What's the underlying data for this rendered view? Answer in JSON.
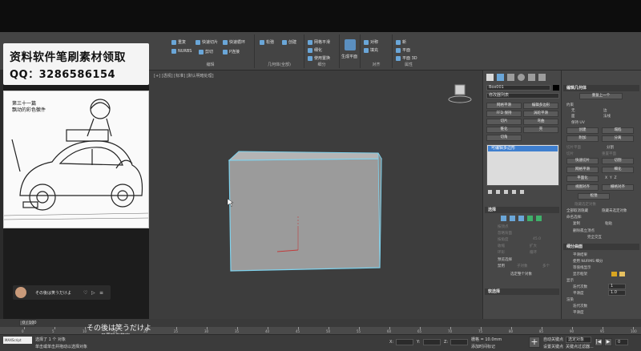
{
  "watermark": {
    "line1": "资料软件笔刷素材领取",
    "line2": "QQ：3286586154"
  },
  "manga": {
    "caption_line1": "第三十一篇",
    "caption_line2": "飘动的彩色徽件"
  },
  "ribbon": {
    "items": [
      "重复",
      "快速切片",
      "快速循环",
      "NURBS",
      "剪切",
      "P连接",
      "松弛",
      "创建",
      "网格平滑",
      "细化",
      "使用置换",
      "生成拓扑",
      "对称",
      "填充",
      "新",
      "平面",
      "平面 3D"
    ],
    "group_labels": [
      "编辑",
      "几何体(全部)",
      "细分",
      "对齐",
      "属性"
    ],
    "big_button": "生成平面"
  },
  "viewport": {
    "label": "[+] [透视] [标准] [默认明暗处理]"
  },
  "command_panel": {
    "object_name": "Box001",
    "modifier_list": "修改器列表",
    "buttons": [
      "网格平滑",
      "编辑多边形",
      "FFD 保持",
      "涡轮平滑",
      "切片",
      "弯曲",
      "锥化",
      "壳",
      "切角"
    ],
    "stack_selected": "可编辑多边形",
    "rollout_selection": "选择",
    "sel_by_vertex": "按顶点",
    "ignore_backfacing": "忽略背面",
    "by_angle": "按角度",
    "angle_value": "45.0",
    "shrink": "收缩",
    "grow": "扩大",
    "ring": "环形",
    "loop": "循环",
    "preview_selection": "预览选择",
    "preview_off": "禁用",
    "preview_sub": "子对象",
    "preview_multi": "多个",
    "whole_selected": "选定整个对象",
    "rollout_soft": "软选择"
  },
  "edit_geometry": {
    "title": "编辑几何体",
    "repeat_last": "重复上一个",
    "constraints": "约束",
    "c_none": "无",
    "c_edge": "边",
    "c_face": "面",
    "c_normal": "法线",
    "preserve_uv": "保持 UV",
    "create": "创建",
    "collapse": "塌陷",
    "attach": "附加",
    "detach": "分离",
    "slice_plane": "切片平面",
    "split": "分割",
    "slice": "切片",
    "reset_plane": "重置平面",
    "quickslice": "快速切片",
    "cut": "切割",
    "meshsmooth": "网格平滑",
    "tessellate": "细化",
    "make_planar": "平面化",
    "view_align": "视图对齐",
    "grid_align": "栅格对齐",
    "relax": "松弛",
    "hide_sel": "隐藏选定对象",
    "unhide_all": "全部取消隐藏",
    "hide_unsel": "隐藏未选定对象",
    "named_sel": "命名选择:",
    "copy": "复制",
    "paste": "粘贴",
    "delete_iso": "删除孤立顶点",
    "full_interactivity": "完全交互"
  },
  "subdivision": {
    "title": "细分曲面",
    "smooth_result": "平滑结果",
    "use_nurms": "使用 NURMS 细分",
    "isoline": "等值线显示",
    "show_cage": "显示框架",
    "display": "显示",
    "iterations_label": "迭代次数",
    "iterations": "1",
    "smoothness_label": "平滑度",
    "smoothness": "1.0",
    "render": "渲染",
    "r_iterations": "迭代次数",
    "r_smoothness": "平滑度"
  },
  "player": {
    "text": "その後は笑うだけよ",
    "heart": "♡",
    "menu": "≡"
  },
  "timeline": {
    "frame_label": "0 / 100",
    "ticks": [
      "0",
      "5",
      "10",
      "15",
      "20",
      "25",
      "30",
      "35",
      "40",
      "45",
      "50",
      "55",
      "60",
      "65",
      "70",
      "75",
      "80",
      "85",
      "90",
      "95",
      "100"
    ]
  },
  "subtitle": {
    "japanese": "その後は笑うだけよ",
    "chinese": "只需陪你笑容"
  },
  "status": {
    "script_box": "MAXScript",
    "line1": "选择了 1 个 对象",
    "line2": "单击或单击并拖动以选择对象",
    "x_label": "X:",
    "y_label": "Y:",
    "z_label": "Z:",
    "grid": "栅格 = 10.0mm",
    "add_time_tag": "添加时间标记",
    "autokey": "自动关键点",
    "selected": "选定对象",
    "set_key": "设置关键点",
    "key_filters": "关键点过滤器...",
    "frame": "0"
  },
  "colors": {
    "accent_blue": "#3f7fcf",
    "box_edge": "#7fd3ee",
    "axis_red": "#c23a3a"
  }
}
